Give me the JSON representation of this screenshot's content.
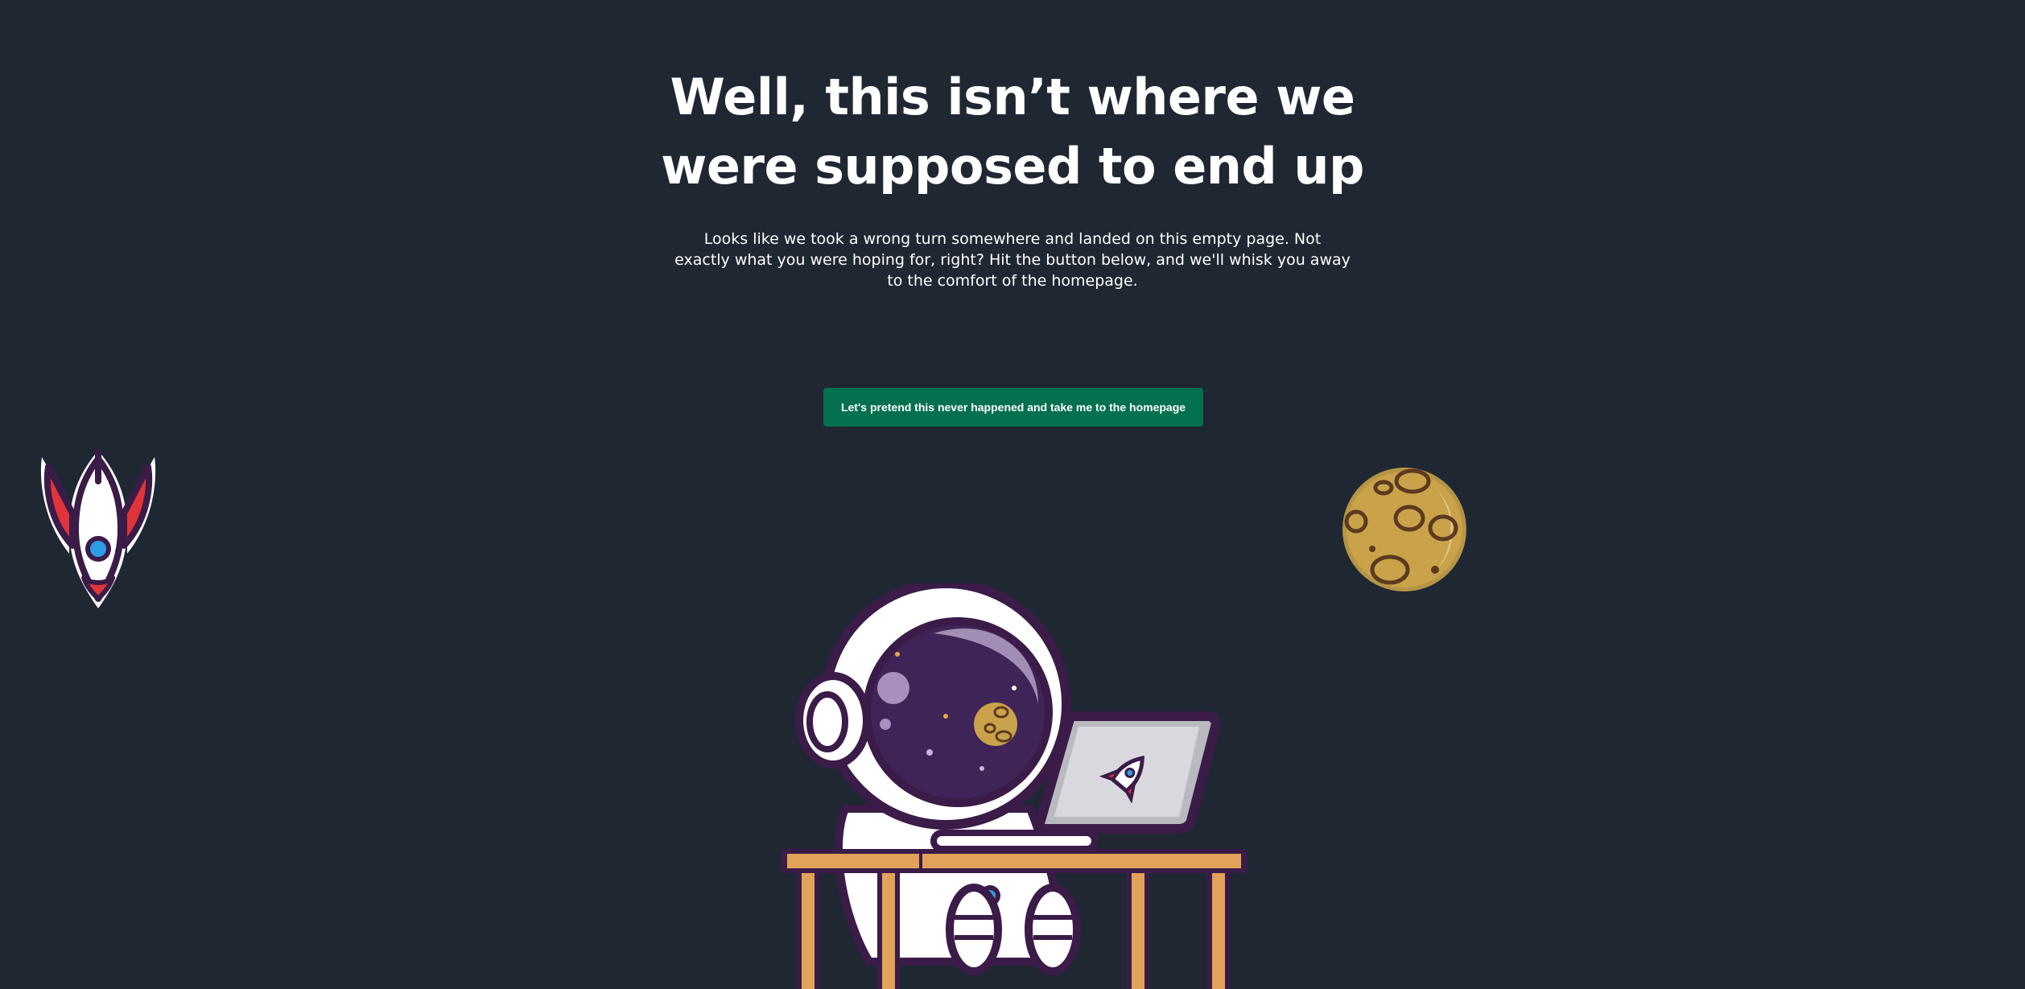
{
  "heading": {
    "line1": "Well, this isn’t where we",
    "line2": "were supposed to end up"
  },
  "description": "Looks like we took a wrong turn somewhere and landed on this empty page. Not exactly what you were hoping for, right? Hit the button below, and we'll whisk you away to the comfort of the homepage.",
  "home_button": {
    "label": "Let's pretend this never happened and take me to the homepage"
  },
  "illustrations": {
    "rocket": "rocket-icon",
    "moon": "moon-icon",
    "astronaut": "astronaut-laptop-illustration"
  },
  "colors": {
    "background": "#1f2733",
    "button": "#03704f",
    "text": "#ffffff",
    "outline": "#3b1b47",
    "rocket_red": "#e0343a",
    "moon_gold": "#c9a24a"
  }
}
